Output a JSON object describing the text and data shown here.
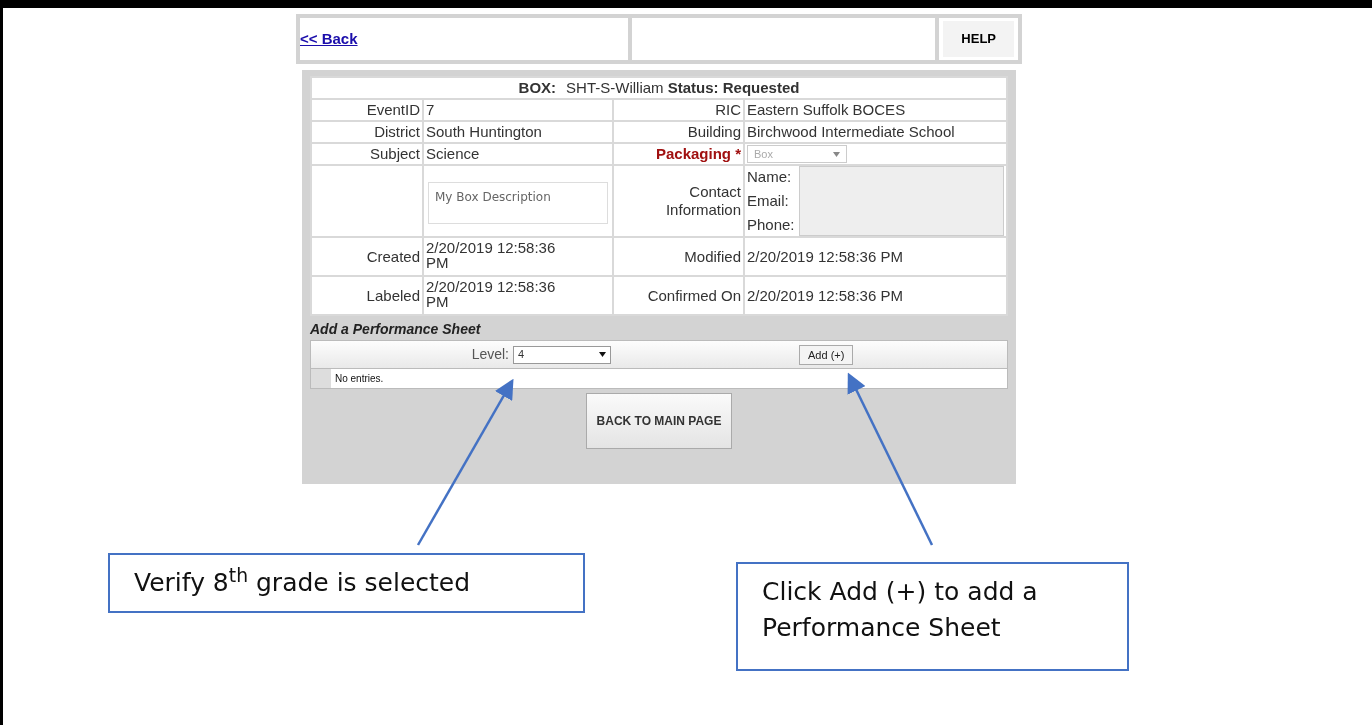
{
  "header": {
    "back_link": "<< Back",
    "help_button": "HELP"
  },
  "box_title": {
    "box_label": "BOX:",
    "box_name": "SHT-S-William",
    "status_label": "Status:",
    "status": "Requested"
  },
  "rows": [
    {
      "left_label": "EventID",
      "left_value": "7",
      "right_label": "RIC",
      "right_value": "Eastern Suffolk BOCES"
    },
    {
      "left_label": "District",
      "left_value": "South Huntington",
      "right_label": "Building",
      "right_value": "Birchwood Intermediate School"
    },
    {
      "left_label": "Subject",
      "left_value": "Science",
      "right_label": "Packaging *",
      "right_required": true,
      "packaging": {
        "value": "Box",
        "disabled": true
      }
    }
  ],
  "description": {
    "placeholder": "My Box Description"
  },
  "contact": {
    "label": "Contact Information",
    "fields": [
      "Name:",
      "Email:",
      "Phone:"
    ]
  },
  "dates": [
    {
      "left_label": "Created",
      "left_value": "2/20/2019 12:58:36 PM",
      "right_label": "Modified",
      "right_value": "2/20/2019 12:58:36 PM"
    },
    {
      "left_label": "Labeled",
      "left_value": "2/20/2019 12:58:36 PM",
      "right_label": "Confirmed On",
      "right_value": "2/20/2019 12:58:36 PM"
    }
  ],
  "performance": {
    "title": "Add a Performance Sheet",
    "level_label": "Level:",
    "level_value": "4",
    "add_button": "Add (+)",
    "empty_text": "No entries."
  },
  "main_button": "BACK TO MAIN PAGE",
  "callouts": [
    {
      "text": "Verify 8$^{th}$ grade is selected"
    },
    {
      "text": "Click Add (+) to add a Performance Sheet"
    }
  ]
}
